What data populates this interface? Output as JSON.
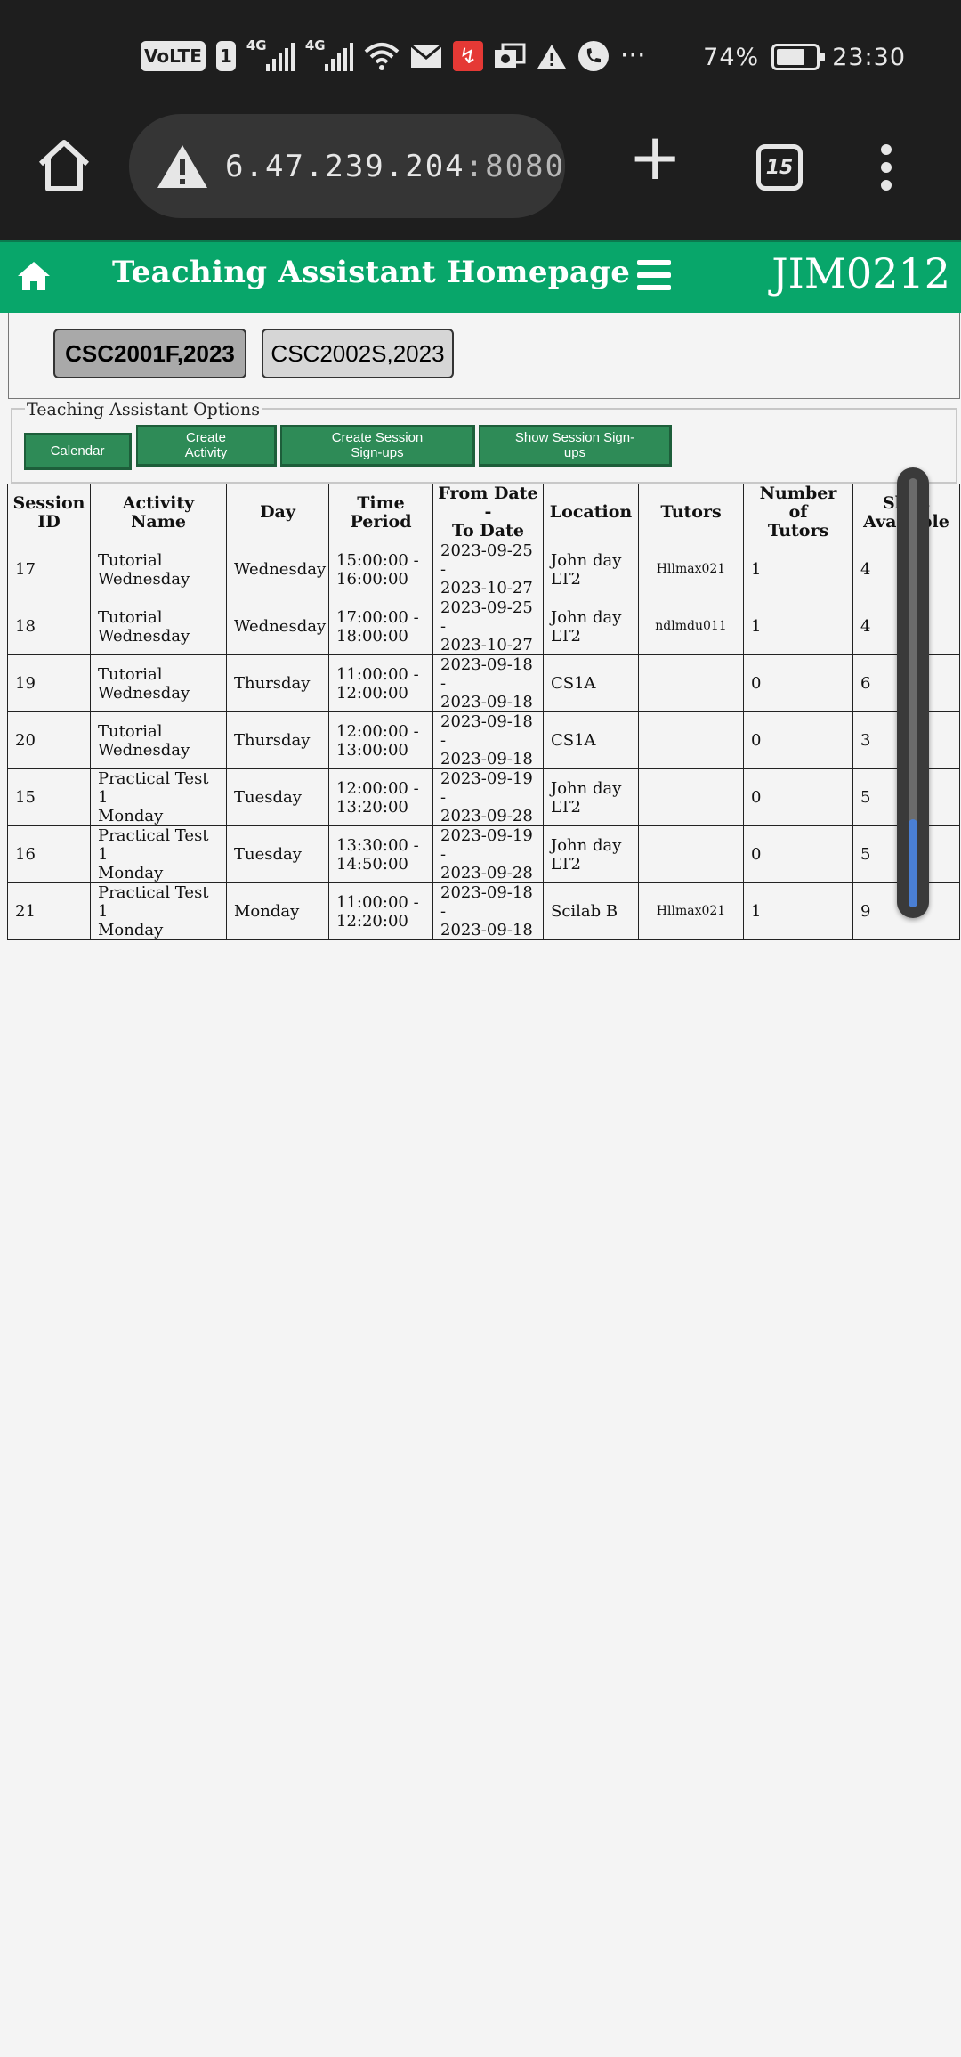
{
  "status_bar": {
    "volte": "VoLTE",
    "sim": "1",
    "net1": "4G",
    "net2": "4G",
    "battery_percent": "74%",
    "battery_level": 0.74,
    "time": "23:30",
    "more": "···",
    "icons": [
      "volte-icon",
      "signal-icon",
      "signal-icon",
      "wifi-icon",
      "mail-icon",
      "alert-app-icon",
      "photo-icon",
      "warning-icon",
      "phone-icon",
      "more-icon"
    ]
  },
  "browser": {
    "url_host": "6.47.239.204",
    "url_port": ":8080",
    "tab_count": "15",
    "icons": [
      "home-icon",
      "insecure-warning-icon",
      "plus-icon",
      "tabs-icon",
      "kebab-menu-icon"
    ]
  },
  "app": {
    "title": "Teaching Assistant Homepage",
    "user": "JIM0212",
    "colors": {
      "header": "#08a66a",
      "button": "#2e8b57"
    }
  },
  "courses": {
    "selected": "CSC2001F,2023",
    "other": "CSC2002S,2023"
  },
  "options": {
    "legend": "Teaching Assistant Options",
    "calendar": "Calendar",
    "create_activity_l1": "Create",
    "create_activity_l2": "Activity",
    "create_signups_l1": "Create Session",
    "create_signups_l2": "Sign-ups",
    "show_signups_l1": "Show Session Sign-",
    "show_signups_l2": "ups"
  },
  "table": {
    "headers": {
      "session_id_l1": "Session",
      "session_id_l2": "ID",
      "activity": "Activity Name",
      "day": "Day",
      "time_l1": "Time",
      "time_l2": "Period",
      "dates_l1": "From Date -",
      "dates_l2": "To Date",
      "location": "Location",
      "tutors": "Tutors",
      "num_l1": "Number of",
      "num_l2": "Tutors",
      "slots_l1": "Slots",
      "slots_l2": "Available"
    },
    "rows": [
      {
        "id": "17",
        "act1": "Tutorial",
        "act2": "Wednesday",
        "day": "Wednesday",
        "t1": "15:00:00 -",
        "t2": "16:00:00",
        "d1": "2023-09-25 -",
        "d2": "2023-10-27",
        "loc1": "John day",
        "loc2": "LT2",
        "tutors": "Hllmax021",
        "num": "1",
        "slots": "4"
      },
      {
        "id": "18",
        "act1": "Tutorial",
        "act2": "Wednesday",
        "day": "Wednesday",
        "t1": "17:00:00 -",
        "t2": "18:00:00",
        "d1": "2023-09-25 -",
        "d2": "2023-10-27",
        "loc1": "John day",
        "loc2": "LT2",
        "tutors": "ndlmdu011",
        "num": "1",
        "slots": "4"
      },
      {
        "id": "19",
        "act1": "Tutorial",
        "act2": "Wednesday",
        "day": "Thursday",
        "t1": "11:00:00 -",
        "t2": "12:00:00",
        "d1": "2023-09-18 -",
        "d2": "2023-09-18",
        "loc1": "CS1A",
        "loc2": "",
        "tutors": "",
        "num": "0",
        "slots": "6"
      },
      {
        "id": "20",
        "act1": "Tutorial",
        "act2": "Wednesday",
        "day": "Thursday",
        "t1": "12:00:00 -",
        "t2": "13:00:00",
        "d1": "2023-09-18 -",
        "d2": "2023-09-18",
        "loc1": "CS1A",
        "loc2": "",
        "tutors": "",
        "num": "0",
        "slots": "3"
      },
      {
        "id": "15",
        "act1": "Practical Test 1",
        "act2": "Monday",
        "day": "Tuesday",
        "t1": "12:00:00 -",
        "t2": "13:20:00",
        "d1": "2023-09-19 -",
        "d2": "2023-09-28",
        "loc1": "John day",
        "loc2": "LT2",
        "tutors": "",
        "num": "0",
        "slots": "5"
      },
      {
        "id": "16",
        "act1": "Practical Test 1",
        "act2": "Monday",
        "day": "Tuesday",
        "t1": "13:30:00 -",
        "t2": "14:50:00",
        "d1": "2023-09-19 -",
        "d2": "2023-09-28",
        "loc1": "John day",
        "loc2": "LT2",
        "tutors": "",
        "num": "0",
        "slots": "5"
      },
      {
        "id": "21",
        "act1": "Practical Test 1",
        "act2": "Monday",
        "day": "Monday",
        "t1": "11:00:00 -",
        "t2": "12:20:00",
        "d1": "2023-09-18 -",
        "d2": "2023-09-18",
        "loc1": "Scilab B",
        "loc2": "",
        "tutors": "Hllmax021",
        "num": "1",
        "slots": "9"
      }
    ]
  },
  "scroll_position": 0.8
}
